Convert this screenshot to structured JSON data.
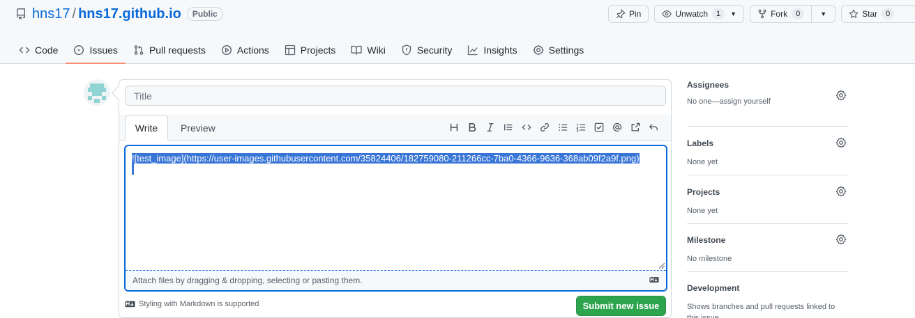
{
  "repo": {
    "owner": "hns17",
    "separator": "/",
    "name": "hns17.github.io",
    "visibility": "Public"
  },
  "header_actions": {
    "pin": "Pin",
    "unwatch": "Unwatch",
    "unwatch_count": "1",
    "fork": "Fork",
    "fork_count": "0",
    "star": "Star",
    "star_count": "0"
  },
  "nav": {
    "tabs": [
      {
        "label": "Code",
        "icon": "code-icon"
      },
      {
        "label": "Issues",
        "icon": "issue-icon",
        "active": true
      },
      {
        "label": "Pull requests",
        "icon": "pull-request-icon"
      },
      {
        "label": "Actions",
        "icon": "play-icon"
      },
      {
        "label": "Projects",
        "icon": "table-icon"
      },
      {
        "label": "Wiki",
        "icon": "book-icon"
      },
      {
        "label": "Security",
        "icon": "shield-icon"
      },
      {
        "label": "Insights",
        "icon": "graph-icon"
      },
      {
        "label": "Settings",
        "icon": "gear-icon"
      }
    ]
  },
  "composer": {
    "title_placeholder": "Title",
    "tab_write": "Write",
    "tab_preview": "Preview",
    "body_text": "![test_image](https://user-images.githubusercontent.com/35824406/182759080-211266cc-7ba0-4366-9636-368ab09f2a9f.png)",
    "attach_hint": "Attach files by dragging & dropping, selecting or pasting them.",
    "markdown_note": "Styling with Markdown is supported",
    "submit_label": "Submit new issue"
  },
  "sidebar": {
    "sections": [
      {
        "title": "Assignees",
        "body": "No one—assign yourself"
      },
      {
        "title": "Labels",
        "body": "None yet"
      },
      {
        "title": "Projects",
        "body": "None yet"
      },
      {
        "title": "Milestone",
        "body": "No milestone"
      },
      {
        "title": "Development",
        "body": "Shows branches and pull requests linked to this issue."
      }
    ]
  },
  "colors": {
    "accent": "#0969da",
    "submit": "#2da44e",
    "tab_underline": "#fd8c73",
    "selection": "#3875d7"
  }
}
